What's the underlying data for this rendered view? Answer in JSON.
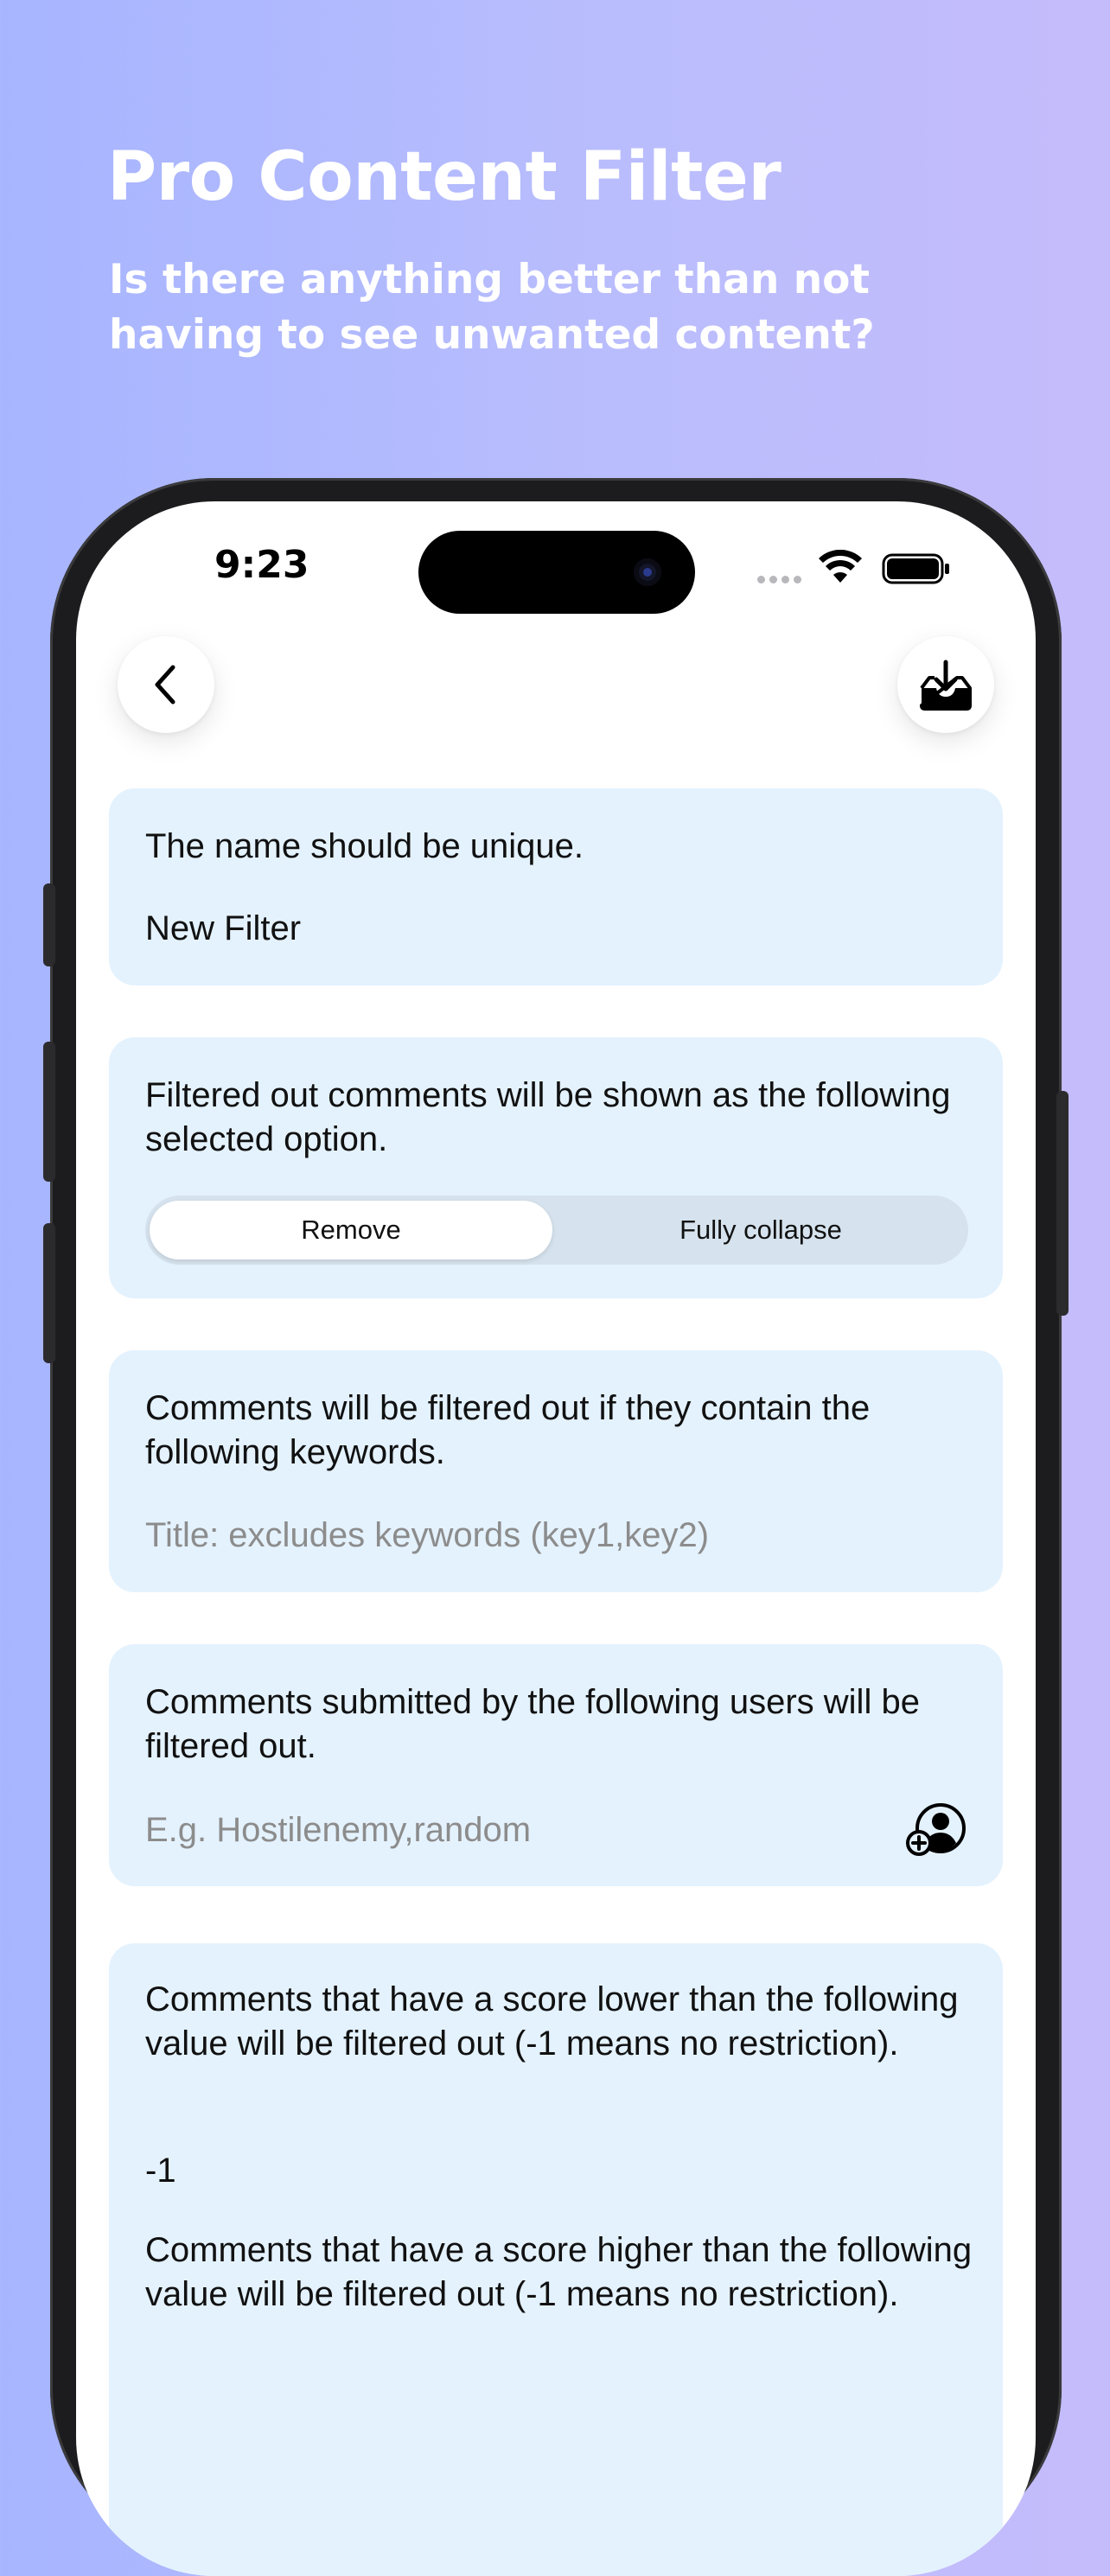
{
  "hero": {
    "title": "Pro Content Filter",
    "subtitle": "Is there anything better than not having to see unwanted content?"
  },
  "status_bar": {
    "time": "9:23",
    "icons": [
      "signal-dots-icon",
      "wifi-icon",
      "battery-icon"
    ]
  },
  "nav": {
    "back_icon": "chevron-left-icon",
    "save_icon": "tray-download-icon"
  },
  "name_section": {
    "hint": "The name should be unique.",
    "value": "New Filter"
  },
  "display_section": {
    "hint": "Filtered out comments will be shown as the following selected option.",
    "options": [
      "Remove",
      "Fully collapse"
    ],
    "selected": "Remove"
  },
  "keywords_section": {
    "hint": "Comments will be filtered out if they contain the following keywords.",
    "placeholder": "Title: excludes keywords (key1,key2)"
  },
  "users_section": {
    "hint": "Comments submitted by the following users will be filtered out.",
    "placeholder": "E.g. Hostilenemy,random",
    "add_user_icon": "add-user-icon"
  },
  "score_section": {
    "min_hint": "Comments that have a score lower than the following value will be filtered out (-1 means no restriction).",
    "min_value": "-1",
    "max_hint": "Comments that have a score higher than the following value will be filtered out (-1 means no restriction)."
  },
  "colors": {
    "background_start": "#a7b5ff",
    "background_end": "#c5bcfb",
    "card_background": "#e4f2fe",
    "segment_track": "#d6e3ee",
    "placeholder_text": "#8c8c8c"
  }
}
